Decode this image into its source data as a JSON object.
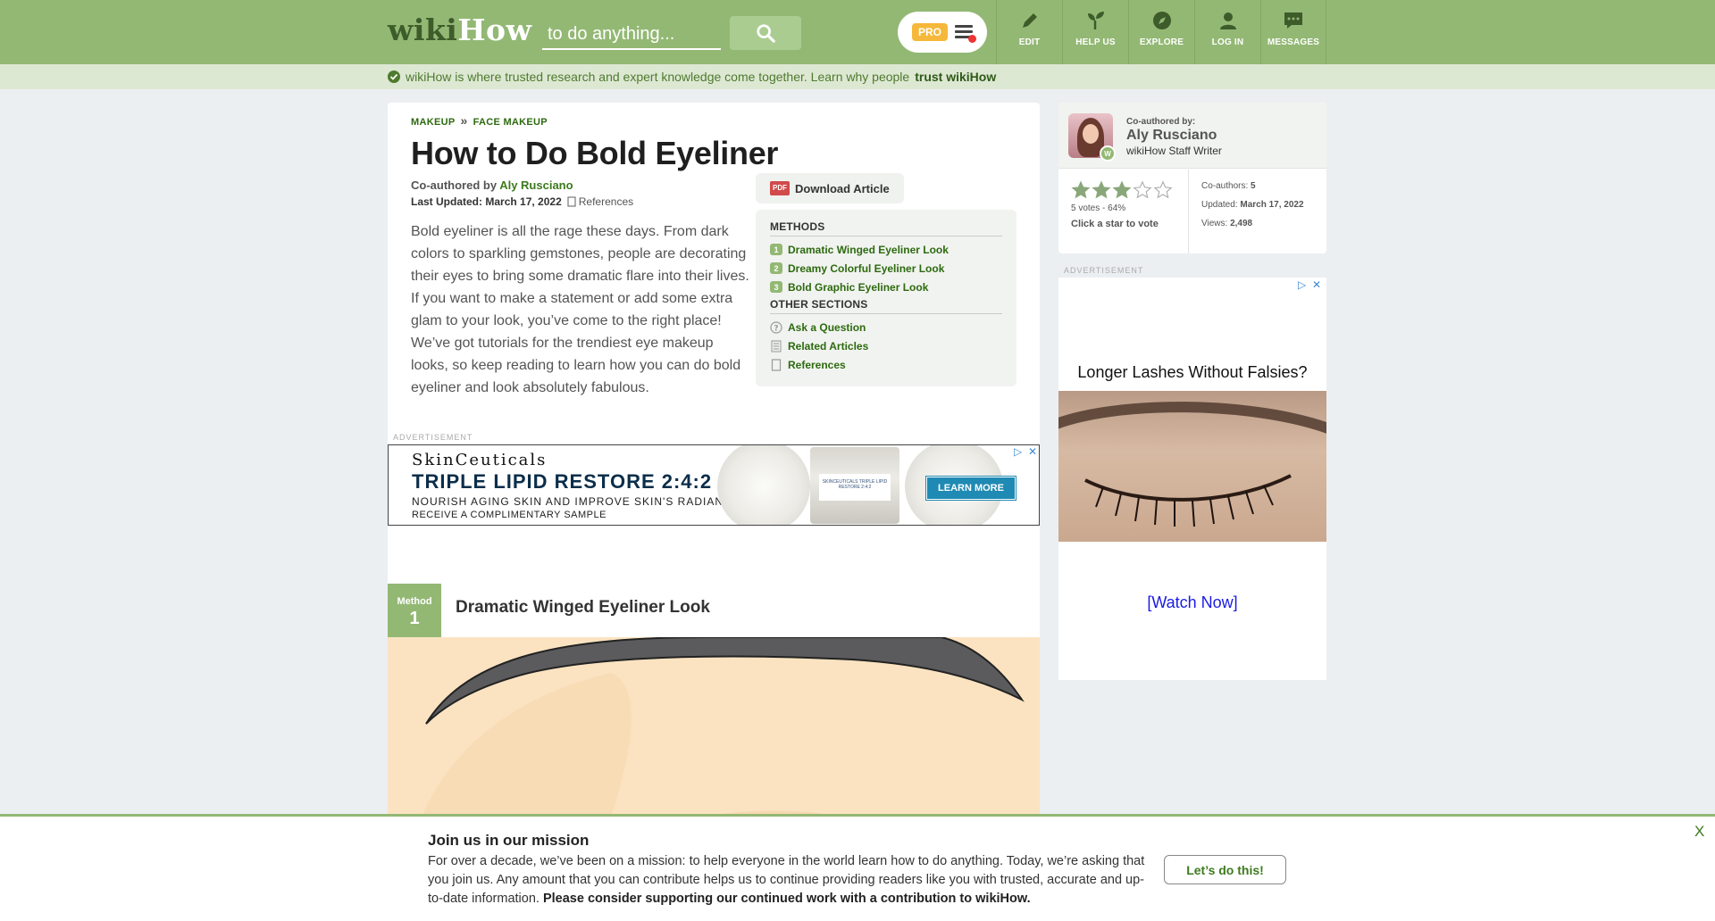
{
  "header": {
    "logo_prefix": "wiki",
    "logo_suffix": "How",
    "search_placeholder": "to do anything...",
    "pro_label": "PRO",
    "nav": [
      {
        "label": "EDIT",
        "icon": "pencil-icon"
      },
      {
        "label": "HELP US",
        "icon": "sprout-icon"
      },
      {
        "label": "EXPLORE",
        "icon": "compass-icon"
      },
      {
        "label": "LOG IN",
        "icon": "user-icon"
      },
      {
        "label": "MESSAGES",
        "icon": "chat-icon"
      }
    ]
  },
  "trust_bar": {
    "text": "wikiHow is where trusted research and expert knowledge come together. Learn why people",
    "link": "trust wikiHow"
  },
  "article": {
    "breadcrumbs": [
      "MAKEUP",
      "FACE MAKEUP"
    ],
    "breadcrumb_sep": "»",
    "title": "How to Do Bold Eyeliner",
    "coauthored_prefix": "Co-authored by",
    "author": "Aly Rusciano",
    "last_updated_label": "Last Updated:",
    "last_updated": "March 17, 2022",
    "references_label": "References",
    "intro": "Bold eyeliner is all the rage these days. From dark colors to sparkling gemstones, people are decorating their eyes to bring some dramatic flare into their lives. If you want to make a statement or add some extra glam to your look, you’ve come to the right place! We’ve got tutorials for the trendiest eye makeup looks, so keep reading to learn how you can do bold eyeliner and look absolutely fabulous.",
    "download_label": "Download Article",
    "pdf_label": "PDF",
    "toc": {
      "methods_heading": "METHODS",
      "methods": [
        {
          "num": "1",
          "label": "Dramatic Winged Eyeliner Look"
        },
        {
          "num": "2",
          "label": "Dreamy Colorful Eyeliner Look"
        },
        {
          "num": "3",
          "label": "Bold Graphic Eyeliner Look"
        }
      ],
      "other_heading": "OTHER SECTIONS",
      "other": [
        {
          "label": "Ask a Question",
          "icon": "question-icon"
        },
        {
          "label": "Related Articles",
          "icon": "document-icon"
        },
        {
          "label": "References",
          "icon": "bookmark-icon"
        }
      ]
    },
    "advertisement_label": "ADVERTISEMENT",
    "method_word": "Method",
    "method_num": "1",
    "method_title": "Dramatic Winged Eyeliner Look"
  },
  "ad_banner": {
    "brand": "SkinCeuticals",
    "headline": "TRIPLE LIPID RESTORE 2:4:2",
    "sub1": "NOURISH AGING SKIN AND IMPROVE SKIN'S RADIANCE",
    "sub2": "RECEIVE A COMPLIMENTARY SAMPLE",
    "cta": "LEARN MORE",
    "jar_label": "SKINCEUTICALS TRIPLE LIPID RESTORE 2:4:2"
  },
  "sidebar": {
    "coauthored_label": "Co-authored by:",
    "author": "Aly Rusciano",
    "role": "wikiHow Staff Writer",
    "avatar_badge": "W",
    "rating_filled": 3,
    "rating_total": 5,
    "votes_text": "5 votes - 64%",
    "vote_cta": "Click a star to vote",
    "coauthors_label": "Co-authors:",
    "coauthors": "5",
    "updated_label": "Updated:",
    "updated": "March 17, 2022",
    "views_label": "Views:",
    "views": "2,498",
    "ad_label": "ADVERTISEMENT",
    "ad_headline": "Longer Lashes Without Falsies?",
    "ad_cta": "[Watch Now]"
  },
  "mission": {
    "title": "Join us in our mission",
    "body": "For over a decade, we’ve been on a mission: to help everyone in the world learn how to do anything. Today, we’re asking that you join us. Any amount that you can contribute helps us to continue providing readers like you with trusted, accurate and up-to-date information.",
    "body_bold": "Please consider supporting our continued work with a contribution to wikiHow.",
    "cta": "Let’s do this!",
    "close": "X"
  },
  "colors": {
    "brand_green": "#93b874",
    "link_green": "#2d6a0f",
    "star_filled": "#8aa77a",
    "pdf_red": "#d14b4b"
  }
}
